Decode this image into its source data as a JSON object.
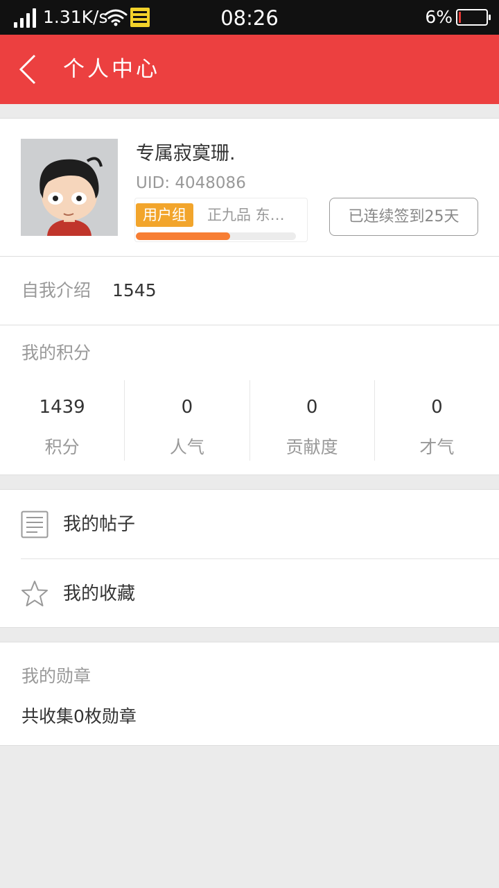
{
  "status_bar": {
    "network_speed": "1.31K/s",
    "time": "08:26",
    "battery_percent": "6%",
    "battery_level": 0.06,
    "icons": [
      "signal-icon",
      "wifi-icon",
      "notification-icon",
      "battery-icon"
    ]
  },
  "header": {
    "title": "个人中心",
    "back_icon": "chevron-left-icon"
  },
  "profile": {
    "username": "专属寂寞珊.",
    "uid": "UID: 4048086",
    "group_badge": "用户组",
    "group_name": "正九品 东…",
    "level_progress": 0.59,
    "checkin_label": "已连续签到25天"
  },
  "intro": {
    "label": "自我介绍",
    "value": "1545"
  },
  "points": {
    "title": "我的积分",
    "items": [
      {
        "value": "1439",
        "label": "积分"
      },
      {
        "value": "0",
        "label": "人气"
      },
      {
        "value": "0",
        "label": "贡献度"
      },
      {
        "value": "0",
        "label": "才气"
      }
    ]
  },
  "menu": {
    "items": [
      {
        "label": "我的帖子",
        "icon": "document-icon"
      },
      {
        "label": "我的收藏",
        "icon": "star-icon"
      }
    ]
  },
  "medals": {
    "title": "我的勋章",
    "summary": "共收集0枚勋章"
  },
  "colors": {
    "header_bg": "#ec4040",
    "badge_bg": "#f2a52c",
    "progress": "#f77e34",
    "battery_low": "#e53935"
  }
}
